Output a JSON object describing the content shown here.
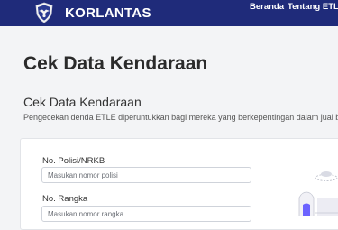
{
  "navbar": {
    "brand": "KORLANTAS",
    "links": [
      {
        "label": "Beranda"
      },
      {
        "label": "Tentang ETLE"
      }
    ],
    "caret": "▾",
    "logo_icon": "korlantas-emblem-icon"
  },
  "page": {
    "title": "Cek Data Kendaraan"
  },
  "section": {
    "title": "Cek Data Kendaraan",
    "description": "Pengecekan denda ETLE diperuntukkan bagi mereka yang berkepentingan dalam jual beli"
  },
  "form": {
    "plate": {
      "label": "No. Polisi/NRKB",
      "placeholder": "Masukan nomor polisi",
      "value": ""
    },
    "chassis": {
      "label": "No. Rangka",
      "placeholder": "Masukan nomor rangka",
      "value": ""
    }
  },
  "colors": {
    "navbar": "#1f2b7a",
    "background": "#f3f4f6",
    "illustration_accent": "#6c63ff"
  }
}
